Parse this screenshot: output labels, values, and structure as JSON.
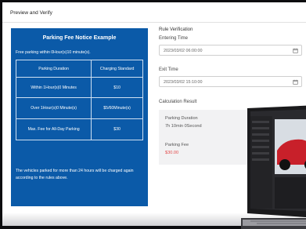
{
  "header": {
    "title": "Preview and Verify"
  },
  "notice": {
    "title": "Parking Fee Notice Example",
    "subtitle": "Free parking within 0Hour(s)10 minute(s).",
    "table": {
      "headers": [
        "Parking Duration",
        "Charging Standard"
      ],
      "rows": [
        [
          "Within 1Hour(s)0 Minutes",
          "$10"
        ],
        [
          "Over 1Hour(s)0 Minute(s)",
          "$5/60Minute(s)"
        ],
        [
          "Max. Fee for All-Day Parking",
          "$30"
        ]
      ]
    },
    "footer": "The vehicles parked for more than 24 hours will be charged again according to the rules above."
  },
  "rule": {
    "title": "Rule Verification",
    "entering_label": "Entering Time",
    "entering_value": "2023/03/02 06:00:00",
    "exit_label": "Exit Time",
    "exit_value": "2023/03/02 15:10:00"
  },
  "calc": {
    "title": "Calculation Result",
    "duration_label": "Parking Duration",
    "duration_value": "7h 10min 0Second",
    "fee_label": "Parking Fee",
    "fee_value": "$30.00"
  },
  "icons": {
    "calendar": "calendar-icon"
  },
  "colors": {
    "notice_bg": "#0b5aa8",
    "fee_red": "#e24b4b"
  }
}
